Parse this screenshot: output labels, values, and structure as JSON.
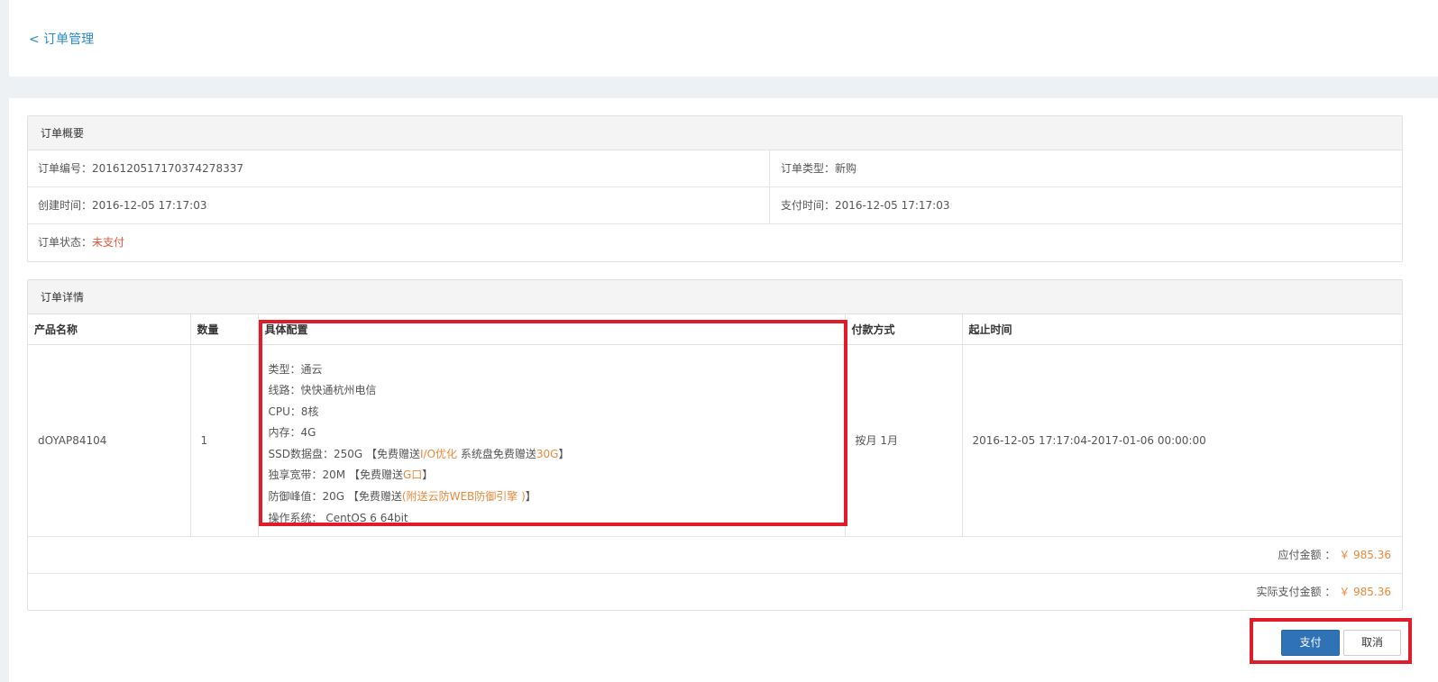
{
  "nav": {
    "back_label": "< 订单管理"
  },
  "summary": {
    "title": "订单概要",
    "order_no_label": "订单编号：",
    "order_no": "20161205171703742783 37",
    "order_type_label": "订单类型：",
    "order_type": "新购",
    "created_label": "创建时间：",
    "created": "2016-12-05 17:17:03",
    "paid_label": "支付时间：",
    "paid": "2016-12-05 17:17:03",
    "status_label": "订单状态：",
    "status": "未支付"
  },
  "details": {
    "title": "订单详情",
    "headers": [
      "产品名称",
      "数量",
      "具体配置",
      "付款方式",
      "起止时间"
    ],
    "row": {
      "product": "dOYAP84104",
      "qty": "1",
      "payment": "按月 1月",
      "period": "2016-12-05 17:17:04-2017-01-06 00:00:00"
    },
    "config": {
      "type": "类型：通云",
      "line": "线路：快快通杭州电信",
      "cpu": "CPU：8核",
      "memory": "内存：4G",
      "ssd_prefix": "SSD数据盘：250G 【免费赠送",
      "ssd_io": "I/O优化",
      "ssd_mid": " 系统盘免费赠送",
      "ssd_sys": "30G",
      "ssd_suffix": "】",
      "bw_prefix": "独享宽带：20M 【免费赠送",
      "bw_gift": "G口",
      "bw_suffix": "】",
      "ddos_prefix": "防御峰值：20G 【免费赠送",
      "ddos_gift": "(附送云防WEB防御引擎 )",
      "ddos_suffix": "】",
      "os": "操作系统： CentOS 6 64bit"
    },
    "payable_label": "应付金额 ：",
    "payable": "￥ 985.36",
    "actual_label": "实际支付金额 ：",
    "actual": "￥ 985.36"
  },
  "actions": {
    "pay": "支付",
    "cancel": "取消"
  },
  "colors": {
    "accent": "#2f72b5",
    "highlight": "#e01b2a",
    "money": "#e8893b"
  }
}
